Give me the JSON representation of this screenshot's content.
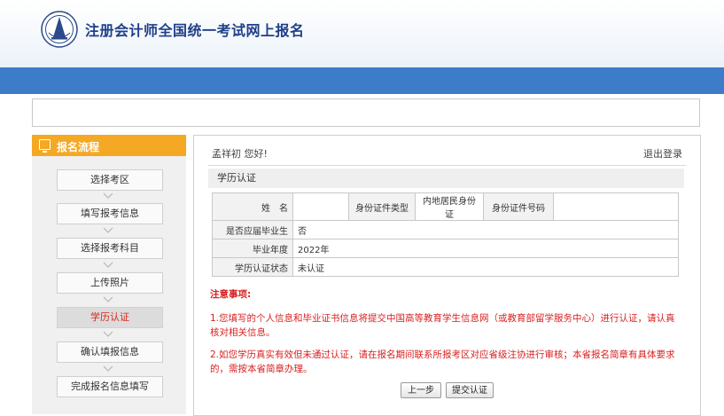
{
  "header": {
    "site_title": "注册会计师全国统一考试网上报名"
  },
  "sidebar": {
    "title": "报名流程",
    "steps": [
      {
        "label": "选择考区"
      },
      {
        "label": "填写报考信息"
      },
      {
        "label": "选择报考科目"
      },
      {
        "label": "上传照片"
      },
      {
        "label": "学历认证",
        "active": true
      },
      {
        "label": "确认填报信息"
      },
      {
        "label": "完成报名信息填写"
      }
    ]
  },
  "main": {
    "greeting": "孟祥初 您好!",
    "logout": "退出登录",
    "section_title": "学历认证",
    "table": {
      "name_label": "姓　名",
      "name_value": "",
      "id_type_label": "身份证件类型",
      "id_type_value": "内地居民身份证",
      "id_no_label": "身份证件号码",
      "id_no_value": "",
      "current_grad_label": "是否应届毕业生",
      "current_grad_value": "否",
      "grad_year_label": "毕业年度",
      "grad_year_value": "2022年",
      "status_label": "学历认证状态",
      "status_value": "未认证"
    },
    "notes": {
      "title": "注意事项:",
      "item1": "1.您填写的个人信息和毕业证书信息将提交中国高等教育学生信息网（或教育部留学服务中心）进行认证，请认真核对相关信息。",
      "item2": "2.如您学历真实有效但未通过认证，请在报名期间联系所报考区对应省级注协进行审核；本省报名简章有具体要求的，需按本省简章办理。"
    },
    "buttons": {
      "prev": "上一步",
      "submit": "提交认证"
    }
  },
  "colors": {
    "primary_blue": "#3d7cc9",
    "sidebar_orange": "#f4a824",
    "notice_red": "#d91f1f",
    "title_blue": "#1f3f8a"
  }
}
